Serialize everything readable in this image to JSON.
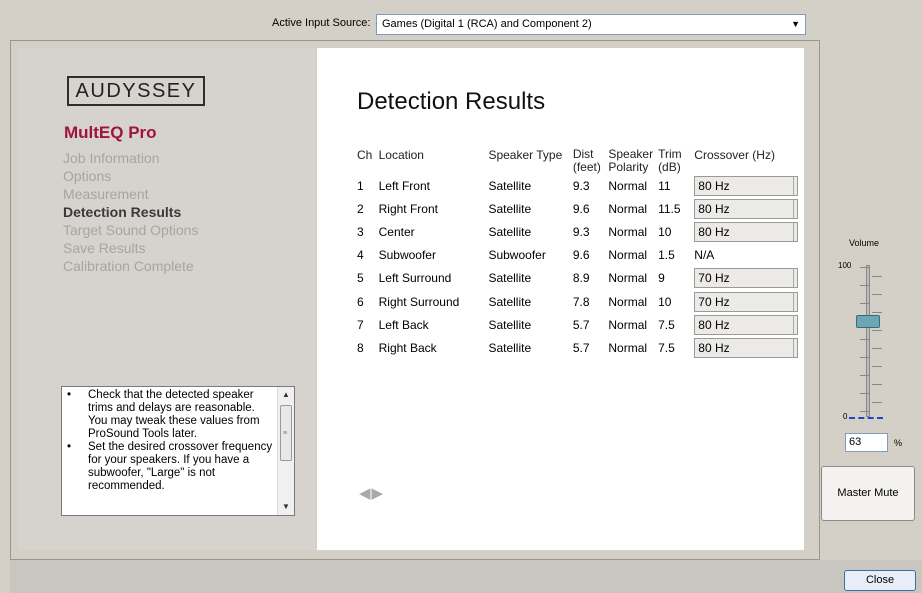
{
  "header": {
    "source_label": "Active Input Source:",
    "source_value": "Games (Digital 1 (RCA) and Component 2)"
  },
  "sidebar": {
    "logo": "AUDYSSEY",
    "product": "MultEQ Pro",
    "steps": [
      {
        "label": "Job Information",
        "active": false
      },
      {
        "label": "Options",
        "active": false
      },
      {
        "label": "Measurement",
        "active": false
      },
      {
        "label": "Detection Results",
        "active": true
      },
      {
        "label": "Target Sound Options",
        "active": false
      },
      {
        "label": "Save Results",
        "active": false
      },
      {
        "label": "Calibration Complete",
        "active": false
      }
    ],
    "help": {
      "bullet": "•",
      "items": [
        "Check that the detected speaker trims and delays are reasonable.  You may tweak these values from ProSound Tools later.",
        "Set the desired crossover frequency for your speakers.  If you have a subwoofer, \"Large\" is not recommended."
      ]
    }
  },
  "main": {
    "title": "Detection Results",
    "columns": {
      "ch": "Ch",
      "location": "Location",
      "speaker_type": "Speaker Type",
      "dist": [
        "Dist",
        "(feet)"
      ],
      "polarity": [
        "Speaker",
        "Polarity"
      ],
      "trim": [
        "Trim",
        "(dB)"
      ],
      "crossover": "Crossover (Hz)"
    },
    "rows": [
      {
        "ch": "1",
        "location": "Left Front",
        "type": "Satellite",
        "dist": "9.3",
        "polarity": "Normal",
        "trim": "11",
        "crossover": "80 Hz",
        "selectable": true
      },
      {
        "ch": "2",
        "location": "Right Front",
        "type": "Satellite",
        "dist": "9.6",
        "polarity": "Normal",
        "trim": "11.5",
        "crossover": "80 Hz",
        "selectable": true
      },
      {
        "ch": "3",
        "location": "Center",
        "type": "Satellite",
        "dist": "9.3",
        "polarity": "Normal",
        "trim": "10",
        "crossover": "80 Hz",
        "selectable": true
      },
      {
        "ch": "4",
        "location": "Subwoofer",
        "type": "Subwoofer",
        "dist": "9.6",
        "polarity": "Normal",
        "trim": "1.5",
        "crossover": "N/A",
        "selectable": false
      },
      {
        "ch": "5",
        "location": "Left Surround",
        "type": "Satellite",
        "dist": "8.9",
        "polarity": "Normal",
        "trim": "9",
        "crossover": "70 Hz",
        "selectable": true
      },
      {
        "ch": "6",
        "location": "Right Surround",
        "type": "Satellite",
        "dist": "7.8",
        "polarity": "Normal",
        "trim": "10",
        "crossover": "70 Hz",
        "selectable": true
      },
      {
        "ch": "7",
        "location": "Left Back",
        "type": "Satellite",
        "dist": "5.7",
        "polarity": "Normal",
        "trim": "7.5",
        "crossover": "80 Hz",
        "selectable": true
      },
      {
        "ch": "8",
        "location": "Right Back",
        "type": "Satellite",
        "dist": "5.7",
        "polarity": "Normal",
        "trim": "7.5",
        "crossover": "80 Hz",
        "selectable": true
      }
    ]
  },
  "volume": {
    "label": "Volume",
    "max_label": "100",
    "min_label": "0",
    "level": 0.63,
    "value": "63",
    "unit": "%",
    "mute_label": "Master Mute"
  },
  "footer": {
    "close_label": "Close"
  }
}
